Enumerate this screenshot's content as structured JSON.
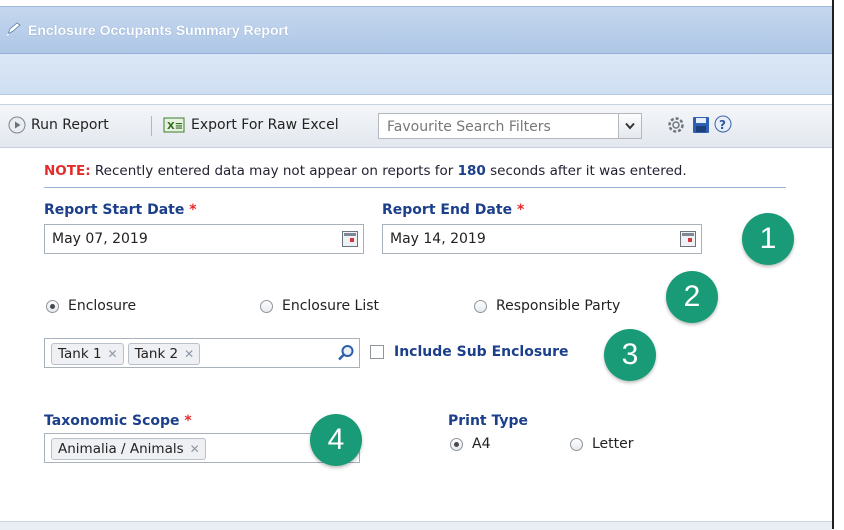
{
  "window": {
    "title": "Enclosure Occupants Summary Report"
  },
  "toolbar": {
    "run_label": "Run Report",
    "export_label": "Export For Raw Excel",
    "favourites_placeholder": "Favourite Search Filters"
  },
  "note": {
    "prefix": "NOTE:",
    "text_before": " Recently entered data may not appear on reports for ",
    "seconds": "180",
    "text_after": " seconds after it was entered."
  },
  "form": {
    "start_date": {
      "label": "Report Start Date",
      "required_mark": "*",
      "value": "May 07, 2019"
    },
    "end_date": {
      "label": "Report End Date",
      "required_mark": "*",
      "value": "May 14, 2019"
    },
    "scope_options": [
      {
        "label": "Enclosure",
        "selected": true
      },
      {
        "label": "Enclosure List",
        "selected": false
      },
      {
        "label": "Responsible Party",
        "selected": false
      }
    ],
    "enclosure_tags": [
      "Tank 1",
      "Tank 2"
    ],
    "include_sub_label": "Include Sub Enclosure",
    "taxonomic_scope": {
      "label": "Taxonomic Scope",
      "required_mark": "*",
      "tags": [
        "Animalia / Animals"
      ]
    },
    "print_type": {
      "label": "Print Type",
      "options": [
        {
          "label": "A4",
          "selected": true
        },
        {
          "label": "Letter",
          "selected": false
        }
      ]
    }
  },
  "callouts": [
    "1",
    "2",
    "3",
    "4"
  ],
  "colors": {
    "callout": "#1a9b78",
    "label_blue": "#1b3f8a",
    "required_red": "#e32b2b"
  }
}
